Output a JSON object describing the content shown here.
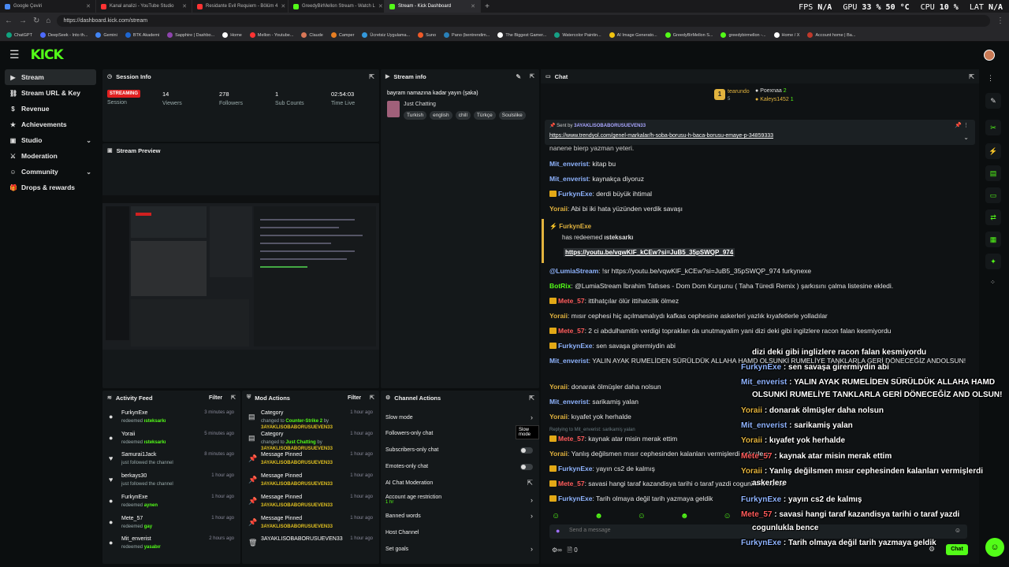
{
  "browser": {
    "tabs": [
      {
        "title": "Google Çeviri",
        "color": "#4a8af4"
      },
      {
        "title": "Kanal analizi - YouTube Studio",
        "color": "#ff3333"
      },
      {
        "title": "Residante Evil Requiem - Bölüm 4",
        "color": "#ff3333"
      },
      {
        "title": "GreedyBirMellon Stream - Watch L",
        "color": "#53fc18"
      },
      {
        "title": "Stream - Kick Dashboard",
        "color": "#53fc18"
      }
    ],
    "url": "https://dashboard.kick.com/stream",
    "perf": {
      "fps_label": "FPS",
      "fps": "N/A",
      "gpu_label": "GPU",
      "gpu": "33 %",
      "gpu_temp": "50 °C",
      "cpu_label": "CPU",
      "cpu": "10 %",
      "lat_label": "LAT",
      "lat": "N/A"
    },
    "bookmarks": [
      "ChatGPT",
      "DeepSeek - Into th...",
      "Gemini",
      "BTK Akademi",
      "Sapphire | Dashbo...",
      "Home",
      "Mellon - Youtube...",
      "Claude",
      "Camper",
      "Ücretsiz Uygulama...",
      "Suno",
      "Pano (bentrendim...",
      "The Biggest Gamer...",
      "Watercolor Paintin...",
      "AI Image Generato...",
      "GreedyBirMellon S...",
      "greedybirmellon -...",
      "Home / X",
      "Account home | Ba..."
    ]
  },
  "app": {
    "logo": "KICK"
  },
  "sidebar": {
    "items": [
      {
        "label": "Stream",
        "icon": "▶",
        "chev": ""
      },
      {
        "label": "Stream URL & Key",
        "icon": "⛓",
        "chev": ""
      },
      {
        "label": "Revenue",
        "icon": "$",
        "chev": ""
      },
      {
        "label": "Achievements",
        "icon": "★",
        "chev": ""
      },
      {
        "label": "Studio",
        "icon": "▣",
        "chev": "⌄"
      },
      {
        "label": "Moderation",
        "icon": "⚔",
        "chev": ""
      },
      {
        "label": "Community",
        "icon": "☺",
        "chev": "⌄"
      },
      {
        "label": "Drops & rewards",
        "icon": "🎁",
        "chev": ""
      }
    ]
  },
  "session": {
    "title": "Session Info",
    "status": "STREAMING",
    "status_label": "Session",
    "viewers": "14",
    "viewers_label": "Viewers",
    "followers": "278",
    "followers_label": "Followers",
    "subs": "1",
    "subs_label": "Sub Counts",
    "time": "02:54:03",
    "time_label": "Time Live"
  },
  "stream_info": {
    "title": "Stream info",
    "stream_title": "bayram namazına kadar yayın (şaka)",
    "category": "Just Chatting",
    "tags": [
      "Turkish",
      "english",
      "chill",
      "Türkçe",
      "Soulslike"
    ]
  },
  "preview": {
    "title": "Stream Preview"
  },
  "activity": {
    "title": "Activity Feed",
    "filter": "Filter",
    "items": [
      {
        "name": "FurkynExe",
        "action": "redeemed",
        "reward": "ısteksarkı",
        "time": "3 minutes ago",
        "icon": "●"
      },
      {
        "name": "Yoraii",
        "action": "redeemed",
        "reward": "ısteksarkı",
        "time": "5 minutes ago",
        "icon": "●"
      },
      {
        "name": "Samurai1Jack",
        "action": "just followed the channel",
        "reward": "",
        "time": "8 minutes ago",
        "icon": "♥"
      },
      {
        "name": "berkays30",
        "action": "just followed the channel",
        "reward": "",
        "time": "1 hour ago",
        "icon": "♥"
      },
      {
        "name": "FurkynExe",
        "action": "redeemed",
        "reward": "aynen",
        "time": "1 hour ago",
        "icon": "●"
      },
      {
        "name": "Mete_57",
        "action": "redeemed",
        "reward": "gay",
        "time": "1 hour ago",
        "icon": "●"
      },
      {
        "name": "Mit_enverist",
        "action": "redeemed",
        "reward": "yasabır",
        "time": "2 hours ago",
        "icon": "●"
      }
    ]
  },
  "mod_actions": {
    "title": "Mod Actions",
    "filter": "Filter",
    "items": [
      {
        "name": "Category",
        "l1": "changed to ",
        "l1b": "Counter-Strike 2",
        "l1c": " by",
        "l2": "3AYAKLISOBABORUSUEVEN33",
        "time": "1 hour ago",
        "icon": "▤"
      },
      {
        "name": "Category",
        "l1": "changed to ",
        "l1b": "Just Chatting",
        "l1c": " by",
        "l2": "3AYAKLISOBABORUSUEVEN33",
        "time": "1 hour ago",
        "icon": "▤"
      },
      {
        "name": "Message Pinned",
        "l1": "",
        "l1b": "",
        "l1c": "",
        "l2": "3AYAKLISOBABORUSUEVEN33",
        "time": "1 hour ago",
        "icon": "📌"
      },
      {
        "name": "Message Pinned",
        "l1": "",
        "l1b": "",
        "l1c": "",
        "l2": "3AYAKLISOBABORUSUEVEN33",
        "time": "1 hour ago",
        "icon": "📌"
      },
      {
        "name": "Message Pinned",
        "l1": "",
        "l1b": "",
        "l1c": "",
        "l2": "3AYAKLISOBABORUSUEVEN33",
        "time": "1 hour ago",
        "icon": "📌"
      },
      {
        "name": "Message Pinned",
        "l1": "",
        "l1b": "",
        "l1c": "",
        "l2": "3AYAKLISOBABORUSUEVEN33",
        "time": "1 hour ago",
        "icon": "📌"
      },
      {
        "name": "3AYAKLISOBABORUSUEVEN33",
        "l1": "",
        "l1b": "",
        "l1c": "",
        "l2": "",
        "time": "1 hour ago",
        "icon": "🗑"
      }
    ]
  },
  "channel_actions": {
    "title": "Channel Actions",
    "tooltip": "Slow mode",
    "items": [
      {
        "label": "Slow mode",
        "control": "chevron",
        "sub": ""
      },
      {
        "label": "Followers-only chat",
        "control": "none",
        "sub": ""
      },
      {
        "label": "Subscribers-only chat",
        "control": "toggle",
        "sub": ""
      },
      {
        "label": "Emotes-only chat",
        "control": "toggle",
        "sub": ""
      },
      {
        "label": "AI Chat Moderation",
        "control": "ext",
        "sub": ""
      },
      {
        "label": "Account age restriction",
        "control": "chevron",
        "sub": "1 hr"
      },
      {
        "label": "Banned words",
        "control": "chevron",
        "sub": ""
      },
      {
        "label": "Host Channel",
        "control": "none",
        "sub": ""
      },
      {
        "label": "Set goals",
        "control": "chevron",
        "sub": ""
      }
    ]
  },
  "chat": {
    "title": "Chat",
    "leaders": {
      "first": "tearundo",
      "first_count": "5",
      "second": "Poexnaa",
      "second_count": "2",
      "third": "Kaleys1452",
      "third_count": "1"
    },
    "pinned": {
      "sent_by": "Sent by",
      "user": "3AYAKLISOBABORUSUEVEN33",
      "link": "https://www.trendyol.com/genel-markalar/h-soba-borusu-h-baca-borusu-emaye-p-34859333"
    },
    "partial_line": "nanene  bierp  yazman yeteri.",
    "messages": [
      {
        "user": "Mit_enverist",
        "color": "blue",
        "crown": false,
        "text": "kitap bu"
      },
      {
        "user": "Mit_enverist",
        "color": "blue",
        "crown": false,
        "text": "kaynakça diyoruz"
      },
      {
        "user": "FurkynExe",
        "color": "blue",
        "crown": true,
        "text": "derdi büyük ihtimal"
      },
      {
        "user": "Yoraii",
        "color": "gold",
        "crown": false,
        "text": "Abi bi iki hata yüzünden verdik savaşı"
      }
    ],
    "redeem": {
      "user": "FurkynExe",
      "has_redeemed": "has redeemed",
      "reward": "ısteksarkı",
      "link": "https://youtu.be/vqwKlF_kCEw?si=JuB5_35pSWQP_974"
    },
    "messages2": [
      {
        "user": "@LumiaStream",
        "color": "blue",
        "crown": false,
        "text": "!sr https://youtu.be/vqwKlF_kCEw?si=JuB5_35pSWQP_974 furkynexe"
      },
      {
        "user": "BotRix",
        "color": "lime",
        "crown": false,
        "text": "@LumiaStream İbrahim Tatlıses - Dom Dom Kurşunu ( Taha Türedi Remix ) şarkısını çalma listesine ekledi."
      },
      {
        "user": "Mete_57",
        "color": "red",
        "crown": true,
        "text": "ittihatçılar ölür ittihatcilik ölmez"
      },
      {
        "user": "Yoraii",
        "color": "gold",
        "crown": false,
        "text": "mısır cephesi hiç açılmamalıydı kafkas cephesine askerleri yazlık kıyafetlerle yolladılar"
      },
      {
        "user": "Mete_57",
        "color": "red",
        "crown": true,
        "text": "2 ci abdulhamitin verdigi toprakları da unutmayalim yani dizi deki gibi ingilzlere racon falan kesmiyordu"
      },
      {
        "user": "FurkynExe",
        "color": "blue",
        "crown": true,
        "text": "sen savaşa girermiydin abi"
      },
      {
        "user": "Mit_enverist",
        "color": "blue",
        "crown": false,
        "text": "YALIN AYAK RUMELİDEN SÜRÜLDÜK ALLAHA HAMD OLSUNKİ RUMELİYE TANKLARLA GERİ DÖNECEĞİZ ANDOLSUN!"
      },
      {
        "user": "Yoraii",
        "color": "gold",
        "crown": false,
        "text": "donarak ölmüşler daha nolsun"
      },
      {
        "user": "Mit_enverist",
        "color": "blue",
        "crown": false,
        "text": "sarikamiş yalan"
      },
      {
        "user": "Yoraii",
        "color": "gold",
        "crown": false,
        "text": "kıyafet yok herhalde"
      }
    ],
    "reply_hint": "Replying to Mit_enverist: sarikamiş yalan",
    "messages3": [
      {
        "user": "Mete_57",
        "color": "red",
        "crown": true,
        "text": "kaynak atar misin merak ettim"
      },
      {
        "user": "Yoraii",
        "color": "gold",
        "crown": false,
        "text": "Yanlış değilsmen mısır cephesinden kalanları vermişlerdi askerlere"
      },
      {
        "user": "FurkynExe",
        "color": "blue",
        "crown": true,
        "text": "yayın cs2 de kalmış"
      },
      {
        "user": "Mete_57",
        "color": "red",
        "crown": true,
        "text": "savasi hangi taraf kazandisya tarihi o taraf yazdi cogunlukla bence"
      },
      {
        "user": "FurkynExe",
        "color": "blue",
        "crown": true,
        "text": "Tarih olmaya değil tarih yazmaya geldik"
      }
    ],
    "input_placeholder": "Send a message",
    "footer_count": "0",
    "send_label": "Chat"
  },
  "overlay": [
    {
      "user": "",
      "text": "dizi deki gibi inglizlere racon falan kesmiyordu",
      "color": "#fff"
    },
    {
      "user": "FurkynExe",
      "text": " : sen savaşa girermiydin abi",
      "color": "#8fb4ff"
    },
    {
      "user": "Mit_enverist",
      "text": " : YALIN AYAK RUMELİDEN SÜRÜLDÜK ALLAHA HAMD",
      "color": "#8fb4ff"
    },
    {
      "user": "",
      "text": "OLSUNKİ RUMELİYE TANKLARLA GERİ DÖNECEĞİZ AND OLSUN!",
      "color": "#fff"
    },
    {
      "user": "Yoraii",
      "text": " : donarak ölmüşler daha nolsun",
      "color": "#e2b33e"
    },
    {
      "user": "Mit_enverist",
      "text": " : sarikamiş yalan",
      "color": "#8fb4ff"
    },
    {
      "user": "Yoraii",
      "text": " : kıyafet yok herhalde",
      "color": "#e2b33e"
    },
    {
      "user": "Mete_57",
      "text": " : kaynak atar misin merak ettim",
      "color": "#ff5b5b"
    },
    {
      "user": "Yoraii",
      "text": " : Yanlış değilsmen mısır cephesinden kalanları vermişlerdi",
      "color": "#e2b33e"
    },
    {
      "user": "",
      "text": "askerlere",
      "color": "#fff"
    },
    {
      "user": "FurkynExe",
      "text": " : yayın cs2 de kalmış",
      "color": "#8fb4ff"
    },
    {
      "user": "Mete_57",
      "text": " : savasi hangi taraf kazandisya tarihi o taraf yazdi",
      "color": "#ff5b5b"
    },
    {
      "user": "",
      "text": "cogunlukla bence",
      "color": "#fff"
    },
    {
      "user": "FurkynExe",
      "text": " : Tarih olmaya değil tarih yazmaya geldik",
      "color": "#8fb4ff"
    }
  ]
}
